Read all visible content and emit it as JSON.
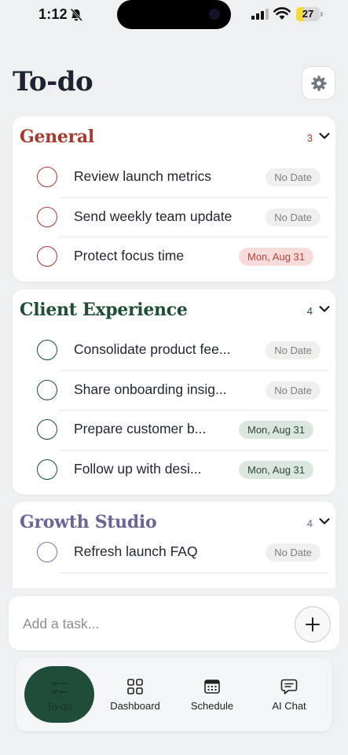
{
  "status_bar": {
    "time": "1:12",
    "battery_level": "27",
    "battery_fraction": 0.27
  },
  "header": {
    "title": "To-do"
  },
  "lists": [
    {
      "title": "General",
      "count": "3",
      "color": "#a33b30",
      "tasks": [
        {
          "title": "Review launch metrics",
          "due": "No Date",
          "chip": "nodate"
        },
        {
          "title": "Send weekly team update",
          "due": "No Date",
          "chip": "nodate"
        },
        {
          "title": "Protect focus time",
          "due": "Mon, Aug 31",
          "chip": "overdue"
        }
      ]
    },
    {
      "title": "Client Experience",
      "count": "4",
      "color": "#1f4d36",
      "tasks": [
        {
          "title": "Consolidate product fee...",
          "due": "No Date",
          "chip": "nodate"
        },
        {
          "title": "Share onboarding insig...",
          "due": "No Date",
          "chip": "nodate"
        },
        {
          "title": "Prepare customer b...",
          "due": "Mon, Aug 31",
          "chip": "dated-green"
        },
        {
          "title": "Follow up with desi...",
          "due": "Mon, Aug 31",
          "chip": "dated-green"
        }
      ]
    },
    {
      "title": "Growth Studio",
      "count": "4",
      "color": "#6e6594",
      "tasks": [
        {
          "title": "Refresh launch FAQ",
          "due": "No Date",
          "chip": "nodate"
        }
      ]
    }
  ],
  "add_task": {
    "placeholder": "Add a task..."
  },
  "nav": {
    "items": [
      {
        "label": "To-do",
        "icon": "checklist-icon",
        "active": true
      },
      {
        "label": "Dashboard",
        "icon": "grid-icon",
        "active": false
      },
      {
        "label": "Schedule",
        "icon": "calendar-icon",
        "active": false
      },
      {
        "label": "AI Chat",
        "icon": "chat-bubble-icon",
        "active": false
      }
    ]
  },
  "colors": {
    "accent_green": "#1f4d3a",
    "background": "#eef0f1"
  }
}
